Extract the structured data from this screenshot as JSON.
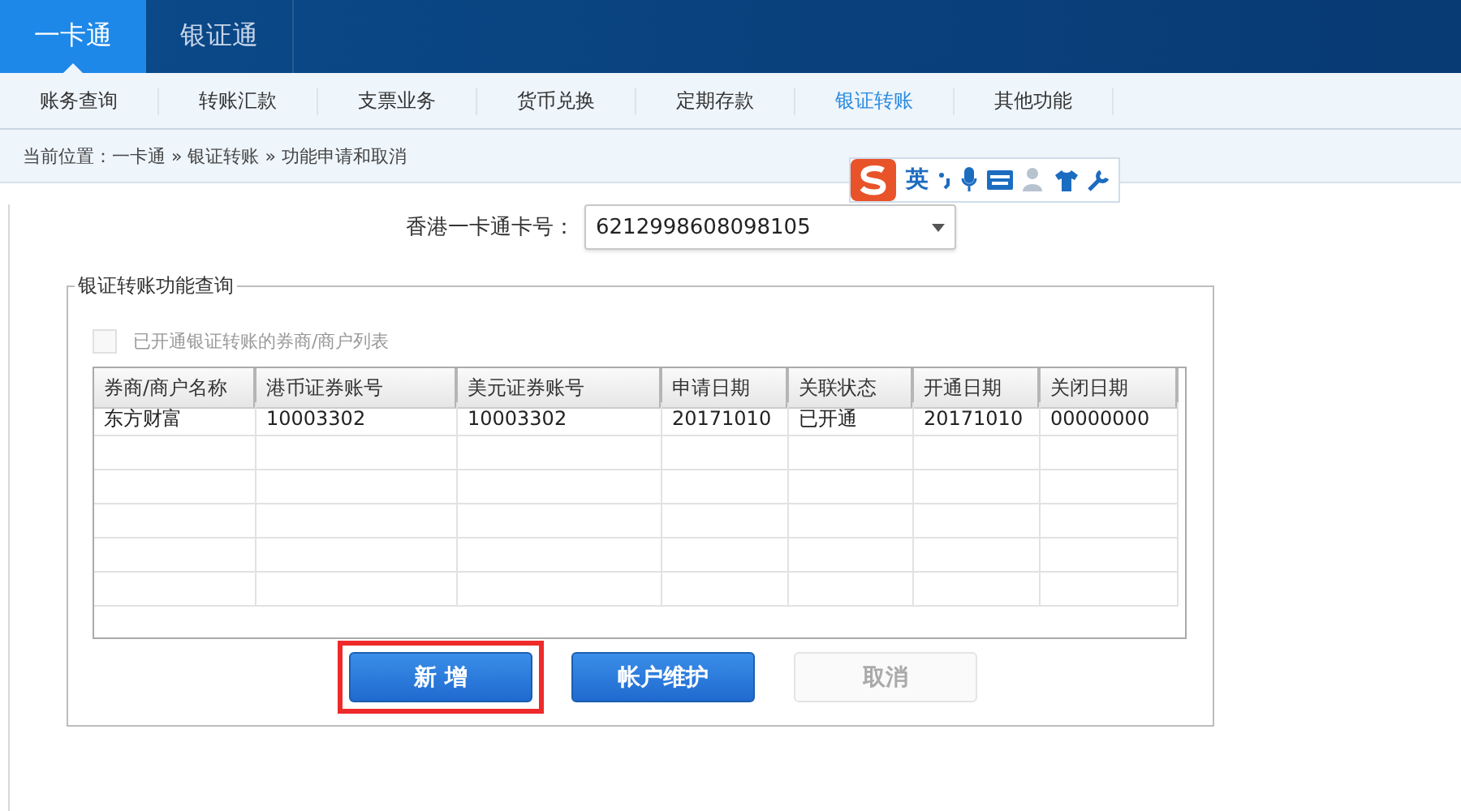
{
  "top_tabs": [
    {
      "label": "一卡通",
      "selected": true
    },
    {
      "label": "银证通",
      "selected": false
    }
  ],
  "sub_nav": [
    {
      "label": "账务查询",
      "selected": false
    },
    {
      "label": "转账汇款",
      "selected": false
    },
    {
      "label": "支票业务",
      "selected": false
    },
    {
      "label": "货币兑换",
      "selected": false
    },
    {
      "label": "定期存款",
      "selected": false
    },
    {
      "label": "银证转账",
      "selected": true
    },
    {
      "label": "其他功能",
      "selected": false
    }
  ],
  "breadcrumb": "当前位置：一卡通 » 银证转账 » 功能申请和取消",
  "ime_toolbar": {
    "mode": "英"
  },
  "card_field": {
    "label": "香港一卡通卡号：",
    "value": "6212998608098105"
  },
  "query_group": {
    "title": "银证转账功能查询",
    "list_option": {
      "label": "已开通银证转账的券商/商户列表",
      "checked": false,
      "disabled": true
    },
    "table": {
      "columns": [
        "券商/商户名称",
        "港币证券账号",
        "美元证券账号",
        "申请日期",
        "关联状态",
        "开通日期",
        "关闭日期"
      ],
      "rows": [
        [
          "东方财富",
          "10003302",
          "10003302",
          "20171010",
          "已开通",
          "20171010",
          "00000000"
        ]
      ]
    },
    "buttons": [
      {
        "label": "新 增",
        "disabled": false,
        "highlighted": true
      },
      {
        "label": "帐户维护",
        "disabled": false,
        "highlighted": false
      },
      {
        "label": "取消",
        "disabled": true,
        "highlighted": false
      }
    ]
  }
}
